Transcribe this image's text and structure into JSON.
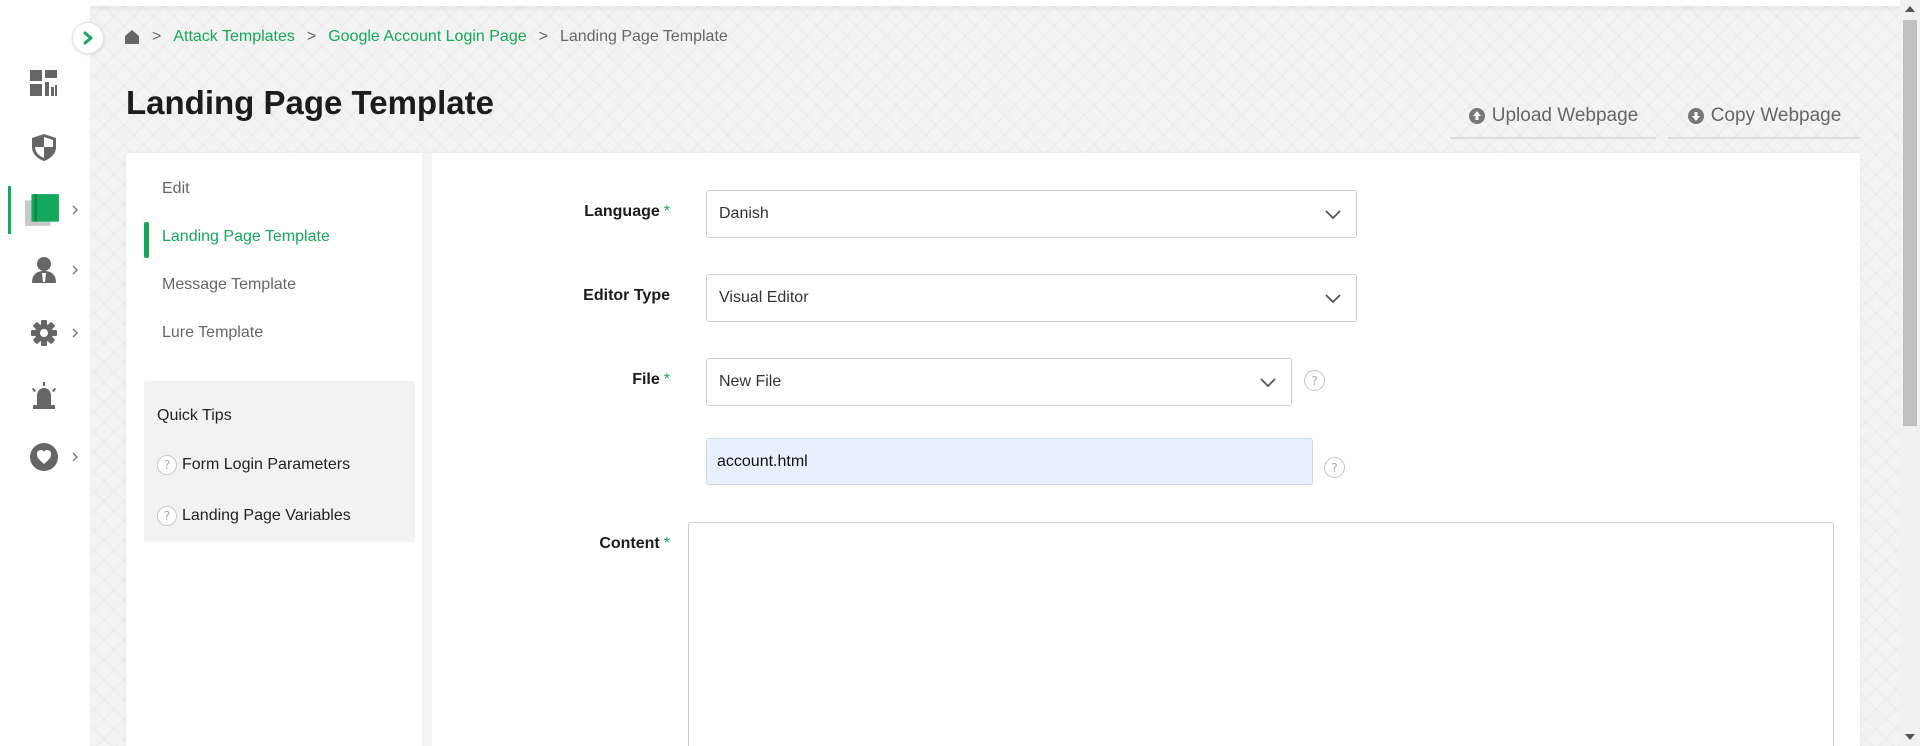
{
  "nav": {
    "items": [
      {
        "icon": "dashboard-icon"
      },
      {
        "icon": "shield-icon"
      },
      {
        "icon": "book-icon"
      },
      {
        "icon": "user-icon"
      },
      {
        "icon": "gear-icon"
      },
      {
        "icon": "alarm-icon"
      },
      {
        "icon": "heart-icon"
      }
    ]
  },
  "breadcrumb": {
    "home_icon": "home-icon",
    "sep1": ">",
    "item1": "Attack Templates",
    "sep2": ">",
    "item2": "Google Account Login Page",
    "sep3": ">",
    "current": "Landing Page Template"
  },
  "page": {
    "title": "Landing Page Template",
    "upload_label": "Upload Webpage",
    "copy_label": "Copy Webpage"
  },
  "side_nav": {
    "items": [
      "Edit",
      "Landing Page Template",
      "Message Template",
      "Lure Template"
    ],
    "active_index": 1
  },
  "tips": {
    "title": "Quick Tips",
    "items": [
      "Form Login Parameters",
      "Landing Page Variables"
    ],
    "help_glyph": "?"
  },
  "form": {
    "language_label": "Language",
    "language_value": "Danish",
    "editor_type_label": "Editor Type",
    "editor_type_value": "Visual Editor",
    "file_label": "File",
    "file_value": "New File",
    "filename_value": "account.html",
    "content_label": "Content",
    "required_mark": "*",
    "help_glyph": "?"
  },
  "colors": {
    "accent": "#14a85a",
    "icon_gray": "#666666",
    "background": "#f3f3f3"
  }
}
